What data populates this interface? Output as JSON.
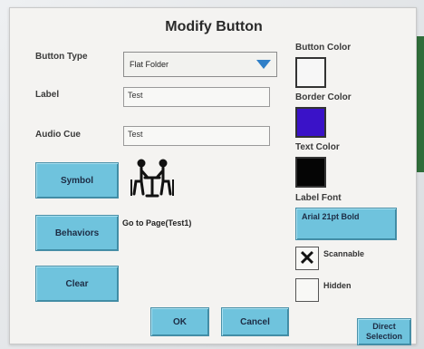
{
  "dialog": {
    "title": "Modify Button"
  },
  "fields": {
    "button_type_label": "Button Type",
    "button_type_value": "Flat Folder",
    "label_label": "Label",
    "label_value": "Test",
    "audio_cue_label": "Audio Cue",
    "audio_cue_value": "Test"
  },
  "buttons": {
    "symbol": "Symbol",
    "behaviors": "Behaviors",
    "clear": "Clear",
    "ok": "OK",
    "cancel": "Cancel",
    "direct_selection_line1": "Direct",
    "direct_selection_line2": "Selection"
  },
  "behavior_text": "Go to Page(Test1)",
  "right_panel": {
    "button_color_label": "Button Color",
    "border_color_label": "Border Color",
    "text_color_label": "Text Color",
    "label_font_label": "Label Font",
    "label_font_value": "Arial 21pt  Bold",
    "scannable_label": "Scannable",
    "hidden_label": "Hidden"
  },
  "colors": {
    "button_color": "#f7f7f7",
    "border_color": "#3a12c8",
    "text_color": "#050505",
    "button_accent": "#6fc3dd"
  },
  "checkboxes": {
    "scannable_checked": true,
    "hidden_checked": false
  },
  "icons": {
    "dropdown": "triangle-down-icon",
    "symbol": "two-people-at-table-icon",
    "checkmark": "x-mark-icon"
  }
}
